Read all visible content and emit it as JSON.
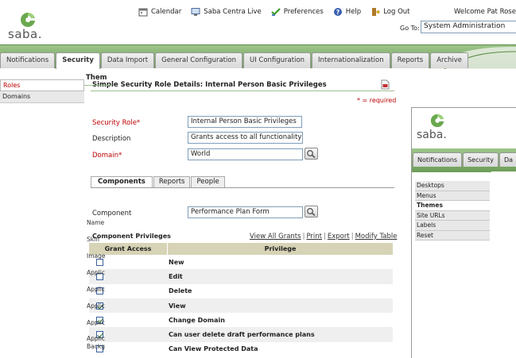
{
  "header": {
    "logo_text": "saba.",
    "nav": [
      {
        "label": "Calendar",
        "icon": "calendar-icon"
      },
      {
        "label": "Saba Centra Live",
        "icon": "monitor-icon"
      },
      {
        "label": "Preferences",
        "icon": "preferences-icon"
      },
      {
        "label": "Help",
        "icon": "help-icon"
      },
      {
        "label": "Log Out",
        "icon": "logout-icon"
      }
    ],
    "welcome": "Welcome Pat Rose",
    "goto_label": "Go To:",
    "goto_value": "System Administration"
  },
  "tabs": [
    "Notifications",
    "Security",
    "Data Import",
    "General Configuration",
    "UI Configuration",
    "Internationalization",
    "Reports",
    "Archive"
  ],
  "active_tab": "Security",
  "leftnav": [
    "Roles",
    "Domains"
  ],
  "page": {
    "title": "Simple Security Role Details: Internal Person Basic Privileges",
    "required_note": "* = required",
    "fields": {
      "security_role_label": "Security Role*",
      "security_role_value": "Internal Person Basic Privileges",
      "description_label": "Description",
      "description_value": "Grants access to all functionality in S",
      "domain_label": "Domain*",
      "domain_value": "World"
    },
    "subtabs": [
      "Components",
      "Reports",
      "People"
    ],
    "component_label": "Component",
    "component_value": "Performance Plan Form",
    "privileges_title": "Component Privileges",
    "links": [
      "View All Grants",
      "Print",
      "Export",
      "Modify Table"
    ],
    "table": {
      "headers": [
        "Grant Access",
        "Privilege"
      ],
      "rows": [
        {
          "checked": false,
          "privilege": "New"
        },
        {
          "checked": false,
          "privilege": "Edit"
        },
        {
          "checked": false,
          "privilege": "Delete"
        },
        {
          "checked": true,
          "privilege": "View"
        },
        {
          "checked": true,
          "privilege": "Change Domain"
        },
        {
          "checked": true,
          "privilege": "Can user delete draft performance plans"
        },
        {
          "checked": false,
          "privilege": "Can View Protected Data"
        }
      ]
    }
  },
  "window2": {
    "logo_text": "saba.",
    "tabs": [
      "Notifications",
      "Security",
      "Da"
    ],
    "nav": [
      "Desktops",
      "Menus",
      "Themes",
      "Site URLs",
      "Labels",
      "Reset"
    ],
    "active_nav": "Themes",
    "title": "Them",
    "labels": [
      "Name",
      "Skin",
      "Image",
      "Applic",
      "Applic",
      "Applic",
      "Applic",
      "Applic",
      "Backg"
    ]
  }
}
